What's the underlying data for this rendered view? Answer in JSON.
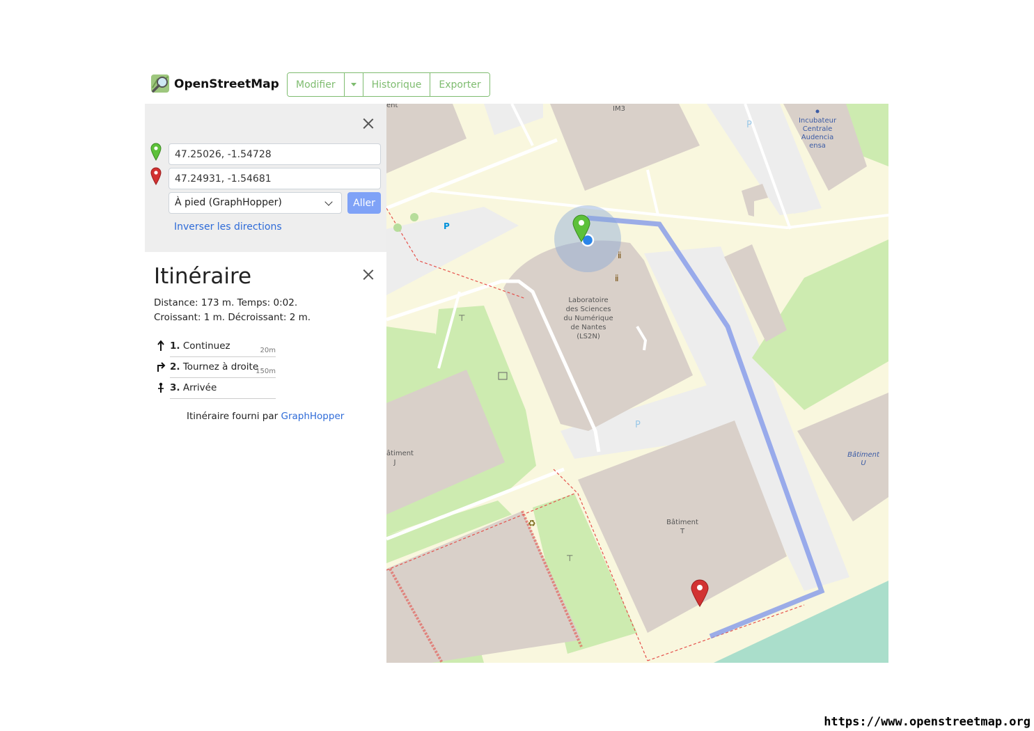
{
  "header": {
    "brand": "OpenStreetMap",
    "buttons": {
      "edit": "Modifier",
      "history": "Historique",
      "export": "Exporter"
    }
  },
  "directions": {
    "from_value": "47.25026, -1.54728",
    "to_value": "47.24931, -1.54681",
    "engine": "À pied (GraphHopper)",
    "go_label": "Aller",
    "reverse_label": "Inverser les directions"
  },
  "route": {
    "title": "Itinéraire",
    "distance_line": "Distance: 173 m. Temps: 0:02.",
    "elevation_line": "Croissant: 1 m. Décroissant: 2 m.",
    "steps": [
      {
        "num": "1.",
        "text": "Continuez",
        "dist": "20m",
        "icon": "arrow-up-icon"
      },
      {
        "num": "2.",
        "text": "Tournez à droite",
        "dist": "150m",
        "icon": "turn-right-icon"
      },
      {
        "num": "3.",
        "text": "Arrivée",
        "dist": "",
        "icon": "destination-icon"
      }
    ],
    "credit_prefix": "Itinéraire fourni par",
    "credit_link": "GraphHopper"
  },
  "map": {
    "labels": {
      "im3": "IM3",
      "incubateur": [
        "Incubateur",
        "Centrale",
        "Audencia",
        "ensa"
      ],
      "lab": [
        "Laboratoire",
        "des Sciences",
        "du Numérique",
        "de Nantes",
        "(LS2N)"
      ],
      "batiment_j": [
        "âtiment",
        "J"
      ],
      "batiment_t": [
        "Bâtiment",
        "T"
      ],
      "batiment_u": [
        "Bâtiment",
        "U"
      ],
      "top_left_fragment": "ent",
      "parking": "P"
    },
    "colors": {
      "background": "#f2efe9",
      "building": "#d9d0c9",
      "grass": "#cdebb0",
      "pedestrian": "#ededed",
      "route": "#7b93ea",
      "water_area": "#aadecb"
    }
  },
  "footer_url": "https://www.openstreetmap.org"
}
